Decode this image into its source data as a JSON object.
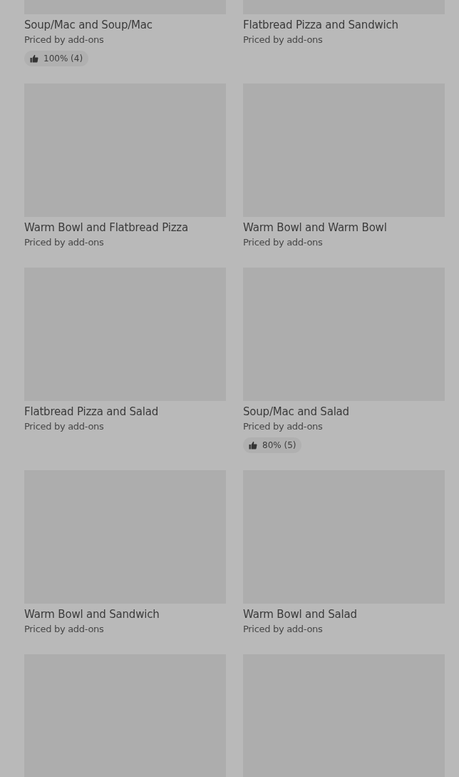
{
  "items": [
    {
      "kind": "placeholder",
      "title": "Soup/Mac and Soup/Mac",
      "subtitle": "Priced by add-ons",
      "rating": "100% (4)"
    },
    {
      "kind": "placeholder",
      "title": "Flatbread Pizza and Sandwich",
      "subtitle": "Priced by add-ons"
    },
    {
      "kind": "placeholder",
      "title": "Warm Bowl and Flatbread Pizza",
      "subtitle": "Priced by add-ons"
    },
    {
      "kind": "placeholder",
      "title": "Warm Bowl and Warm Bowl",
      "subtitle": "Priced by add-ons"
    },
    {
      "kind": "placeholder",
      "title": "Flatbread Pizza and Salad",
      "subtitle": "Priced by add-ons"
    },
    {
      "kind": "placeholder",
      "title": "Soup/Mac and Salad",
      "subtitle": "Priced by add-ons",
      "rating": "80% (5)"
    },
    {
      "kind": "placeholder",
      "title": "Warm Bowl and Sandwich",
      "subtitle": "Priced by add-ons"
    },
    {
      "kind": "placeholder",
      "title": "Warm Bowl and Salad",
      "subtitle": "Priced by add-ons"
    },
    {
      "kind": "placeholder"
    },
    {
      "kind": "placeholder"
    }
  ]
}
